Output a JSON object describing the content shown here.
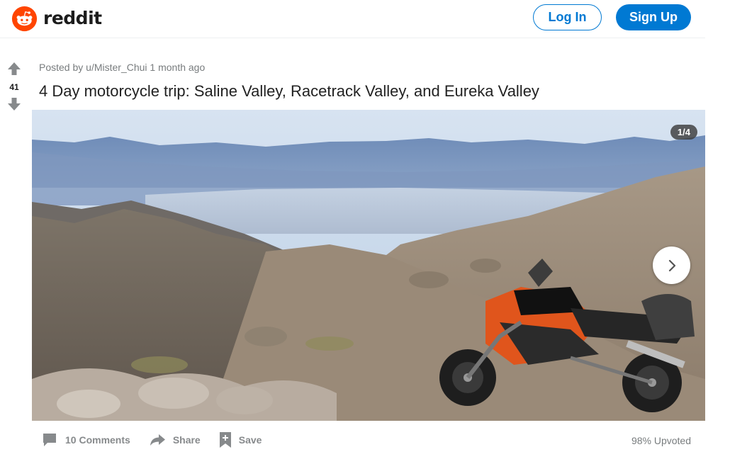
{
  "header": {
    "brand": "reddit",
    "login_label": "Log In",
    "signup_label": "Sign Up",
    "brand_color": "#ff4500",
    "accent_color": "#0079d3"
  },
  "post": {
    "score": "41",
    "meta": "Posted by u/Mister_Chui 1 month ago",
    "title": "4 Day motorcycle trip: Saline Valley, Racetrack Valley, and Eureka Valley",
    "gallery_counter": "1/4",
    "comments_label": "10 Comments",
    "share_label": "Share",
    "save_label": "Save",
    "upvoted_label": "98% Upvoted"
  },
  "icons": {
    "logo": "reddit-snoo-icon",
    "upvote": "upvote-arrow-icon",
    "downvote": "downvote-arrow-icon",
    "next": "chevron-right-icon",
    "comments": "comment-bubble-icon",
    "share": "share-arrow-icon",
    "save": "bookmark-plus-icon"
  }
}
